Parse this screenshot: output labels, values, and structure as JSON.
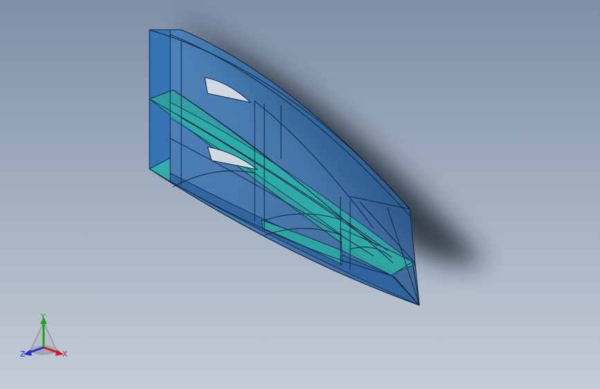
{
  "triad": {
    "x_label": "X",
    "y_label": "Y",
    "z_label": "Z"
  },
  "colors": {
    "background_top": "#7f8fa6",
    "background_bottom": "#c4ccd6",
    "part_transparent_blue": "#2f6eb0",
    "part_teal_face": "#2fa5a0",
    "edge_dark": "#0d2440",
    "axis_x": "#cc2020",
    "axis_y": "#1aa31a",
    "axis_z": "#2030c8"
  }
}
